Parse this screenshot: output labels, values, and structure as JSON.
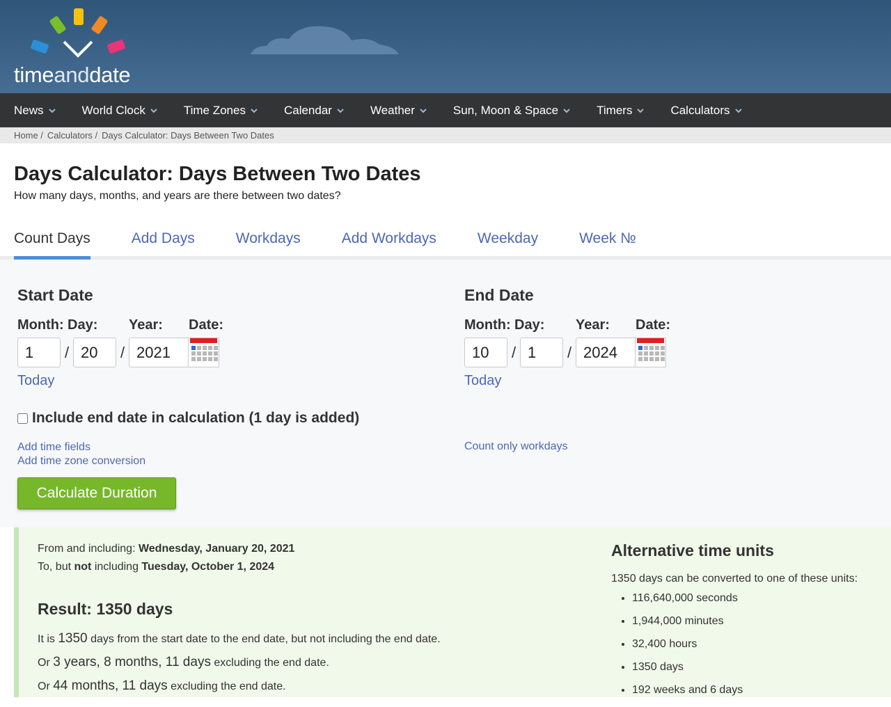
{
  "brand": {
    "part1": "time",
    "part2": "and",
    "part3": "date"
  },
  "nav": [
    {
      "label": "News"
    },
    {
      "label": "World Clock"
    },
    {
      "label": "Time Zones"
    },
    {
      "label": "Calendar"
    },
    {
      "label": "Weather"
    },
    {
      "label": "Sun, Moon & Space"
    },
    {
      "label": "Timers"
    },
    {
      "label": "Calculators"
    }
  ],
  "breadcrumb": [
    "Home /",
    "Calculators /",
    "Days Calculator: Days Between Two Dates"
  ],
  "page": {
    "title": "Days Calculator: Days Between Two Dates",
    "subtitle": "How many days, months, and years are there between two dates?"
  },
  "tabs": [
    "Count Days",
    "Add Days",
    "Workdays",
    "Add Workdays",
    "Weekday",
    "Week №"
  ],
  "form": {
    "start": {
      "heading": "Start Date",
      "month": "1",
      "day": "20",
      "year": "2021"
    },
    "end": {
      "heading": "End Date",
      "month": "10",
      "day": "1",
      "year": "2024"
    },
    "labels": {
      "month": "Month:",
      "day": "Day:",
      "year": "Year:",
      "date": "Date:"
    },
    "slash": "/",
    "today": "Today",
    "include_end": "Include end date in calculation (1 day is added)",
    "add_time_fields": "Add time fields",
    "add_tz": "Add time zone conversion",
    "count_workdays": "Count only workdays",
    "calculate": "Calculate Duration"
  },
  "result": {
    "from_prefix": "From and including:",
    "from_date": "Wednesday, January 20, 2021",
    "to_prefix1": "To, but",
    "to_not": "not",
    "to_prefix2": "including",
    "to_date": "Tuesday, October 1, 2024",
    "heading": "Result: 1350 days",
    "line1_pre": "It is",
    "line1_num": "1350",
    "line1_post": "days from the start date to the end date, but not including the end date.",
    "line2_pre": "Or",
    "line2_val": "3 years, 8 months, 11 days",
    "line2_post": "excluding the end date.",
    "line3_pre": "Or",
    "line3_val": "44 months, 11 days",
    "line3_post": "excluding the end date."
  },
  "alt": {
    "heading": "Alternative time units",
    "intro": "1350 days can be converted to one of these units:",
    "items": [
      "116,640,000 seconds",
      "1,944,000 minutes",
      "32,400 hours",
      "1350 days",
      "192 weeks and 6 days"
    ]
  }
}
